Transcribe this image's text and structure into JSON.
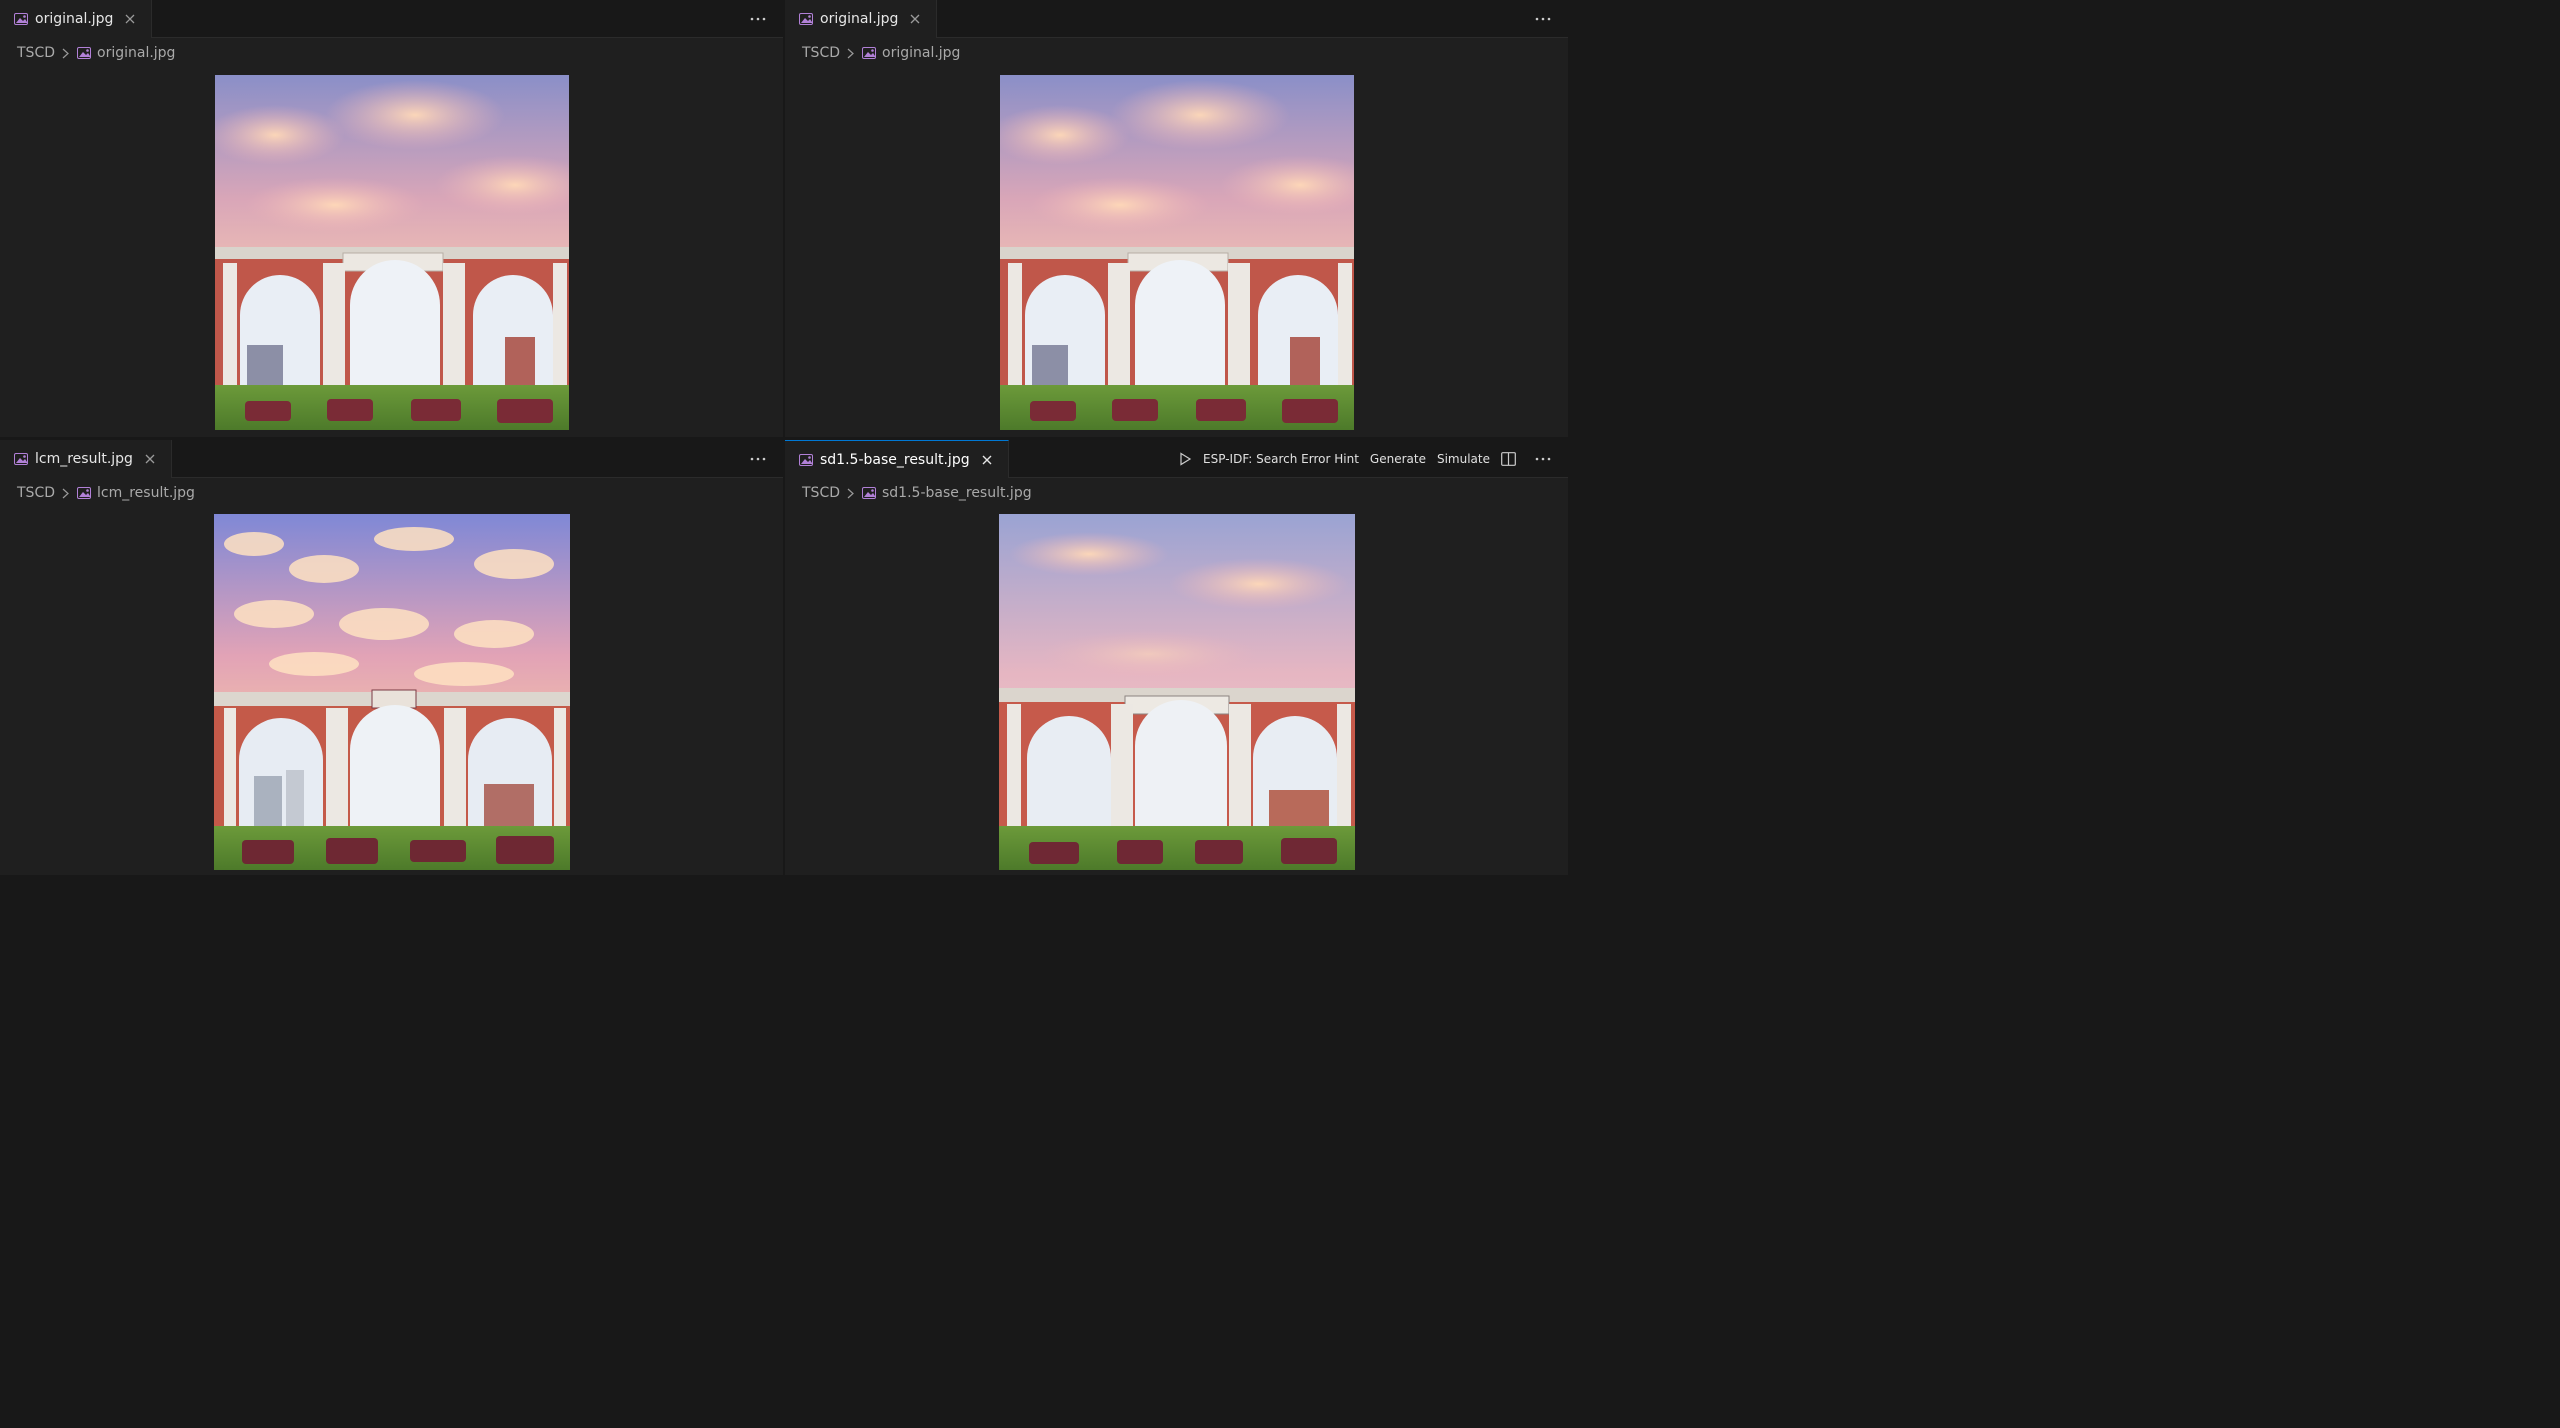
{
  "panes": [
    {
      "tab": {
        "label": "original.jpg",
        "icon": "image-file-icon"
      },
      "breadcrumb": {
        "root": "TSCD",
        "file": "original.jpg"
      },
      "image": {
        "description_name": "gate-photo-original",
        "banner_text": "",
        "ground_text": ""
      }
    },
    {
      "tab": {
        "label": "original.jpg",
        "icon": "image-file-icon"
      },
      "breadcrumb": {
        "root": "TSCD",
        "file": "original.jpg"
      },
      "image": {
        "description_name": "gate-photo-original"
      }
    },
    {
      "tab": {
        "label": "lcm_result.jpg",
        "icon": "image-file-icon"
      },
      "breadcrumb": {
        "root": "TSCD",
        "file": "lcm_result.jpg"
      },
      "image": {
        "description_name": "gate-photo-lcm"
      }
    },
    {
      "tab": {
        "label": "sd1.5-base_result.jpg",
        "icon": "image-file-icon"
      },
      "breadcrumb": {
        "root": "TSCD",
        "file": "sd1.5-base_result.jpg"
      },
      "image": {
        "description_name": "gate-photo-sd15"
      },
      "actions": {
        "run": "play-icon",
        "esp_idf": "ESP-IDF: Search Error Hint",
        "generate": "Generate",
        "simulate": "Simulate",
        "split": "split-editor-icon"
      }
    }
  ],
  "colors": {
    "accent": "#0078d4",
    "icon_purple": "#b180d7",
    "background": "#1f1f1f"
  }
}
